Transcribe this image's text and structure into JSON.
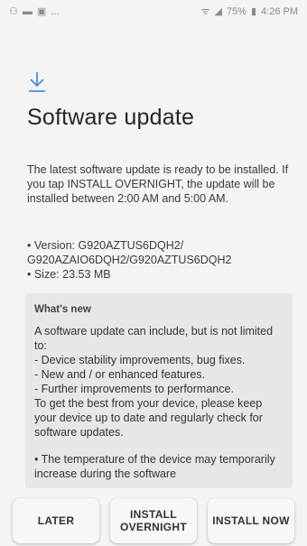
{
  "status_bar": {
    "left_icons": [
      "notification-icon",
      "message-icon",
      "gallery-icon"
    ],
    "left_more": "...",
    "battery_percent": "75%",
    "time": "4:26 PM"
  },
  "header": {
    "icon": "download-icon",
    "title": "Software update"
  },
  "intro": "The latest software update is ready to be installed. If you tap INSTALL OVERNIGHT, the update will be installed between 2:00 AM and 5:00 AM.",
  "details": {
    "version": "• Version: G920AZTUS6DQH2/ G920AZAIO6DQH2/G920AZTUS6DQH2",
    "size": "• Size: 23.53 MB"
  },
  "whats_new": {
    "title": "What's new",
    "body": "A software update can include, but is not limited to:\n - Device stability improvements, bug fixes.\n - New and / or enhanced features.\n - Further improvements to performance.\nTo get the best from your device, please keep your device up to date and regularly check for software updates.",
    "note": "• The temperature of the device may temporarily increase during the software"
  },
  "actions": {
    "later": "LATER",
    "install_overnight": "INSTALL\nOVERNIGHT",
    "install_now": "INSTALL NOW"
  }
}
